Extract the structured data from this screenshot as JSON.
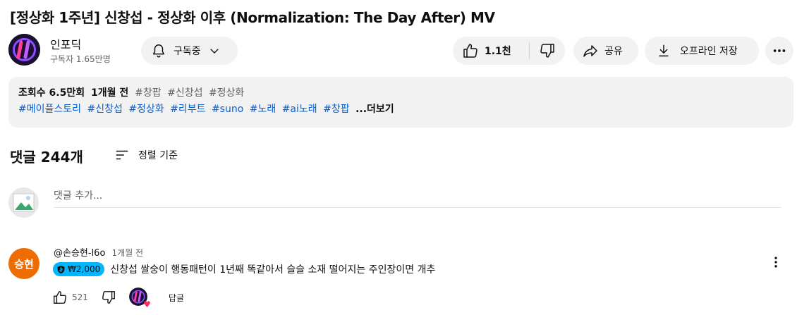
{
  "video": {
    "title": "[정상화 1주년] 신창섭 - 정상화 이후 (Normalization: The Day After) MV"
  },
  "channel": {
    "name": "인포딕",
    "subscribers": "구독자 1.65만명",
    "subscribe_label": "구독중"
  },
  "actions": {
    "like_count": "1.1천",
    "share_label": "공유",
    "download_label": "오프라인 저장"
  },
  "description": {
    "views": "조회수 6.5만회",
    "age": "1개월 전",
    "header_tags": [
      "#창팝",
      "#신창섭",
      "#정상화"
    ],
    "tags": [
      "#메이플스토리",
      "#신창섭",
      "#정상화",
      "#리부트",
      "#suno",
      "#노래",
      "#ai노래",
      "#창팝"
    ],
    "more_label": "...더보기"
  },
  "comments": {
    "count_label": "댓글 244개",
    "sort_label": "정렬 기준",
    "add_placeholder": "댓글 추가...",
    "items": [
      {
        "avatar_text": "승현",
        "avatar_color": "#ef6c00",
        "author": "@손승현-l6o",
        "time": "1개월 전",
        "thanks_amount": "₩2,000",
        "text": "신창섭 쌀숭이 행동패턴이 1년째 똑같아서 슬슬 소재 떨어지는 주인장이면 개추",
        "likes": "521",
        "reply_label": "답글"
      }
    ]
  },
  "icons": {
    "bell": "bell-icon",
    "chevron": "chevron-down-icon",
    "like": "thumbs-up-icon",
    "dislike": "thumbs-down-icon",
    "share": "share-arrow-icon",
    "download": "download-icon",
    "more": "more-horizontal-icon",
    "sort": "sort-icon",
    "more_vertical": "more-vertical-icon",
    "heart": "heart-icon"
  },
  "colors": {
    "link": "#065fd4",
    "pill_bg": "#f2f2f2",
    "thanks_bg": "#00b7ff",
    "heart": "#ff2a55"
  }
}
